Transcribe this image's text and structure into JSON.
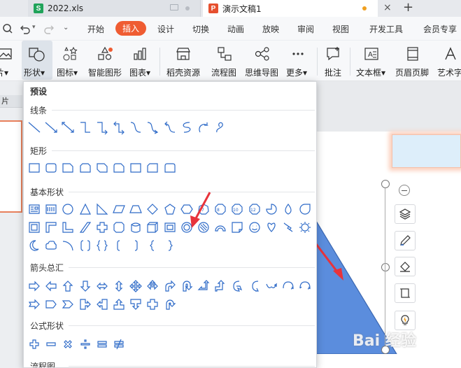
{
  "tabs": [
    {
      "icon_letter": "S",
      "label": "2022.xls",
      "icon_color": "#20a35a"
    },
    {
      "icon_letter": "P",
      "label": "演示文稿1",
      "icon_color": "#e6502f"
    }
  ],
  "new_tab_symbol": "+",
  "menu": {
    "items": [
      "开始",
      "插入",
      "设计",
      "切换",
      "动画",
      "放映",
      "审阅",
      "视图",
      "开发工具",
      "会员专享"
    ],
    "active": "插入"
  },
  "ribbon": {
    "buttons": [
      "片▾",
      "形状▾",
      "图标▾",
      "智能图形",
      "图表▾",
      "稻壳资源",
      "流程图",
      "思维导图",
      "更多▾",
      "批注",
      "文本框▾",
      "页眉页脚",
      "艺术字"
    ]
  },
  "left_panel": {
    "label": "片"
  },
  "dropdown": {
    "header": "预设",
    "sections": [
      "线条",
      "矩形",
      "基本形状",
      "箭头总汇",
      "公式形状",
      "流程图"
    ]
  },
  "watermark": "Bai 经验",
  "colors": {
    "accent": "#ef5c32",
    "triangle": "#5b8ddd",
    "arrow": "#e8333b",
    "shape_stroke": "#2f6bc8"
  },
  "icons": [
    "undo-icon",
    "redo-icon",
    "minus-icon",
    "layers-icon",
    "pen-icon",
    "fill-icon",
    "crop-icon",
    "bulb-icon"
  ]
}
